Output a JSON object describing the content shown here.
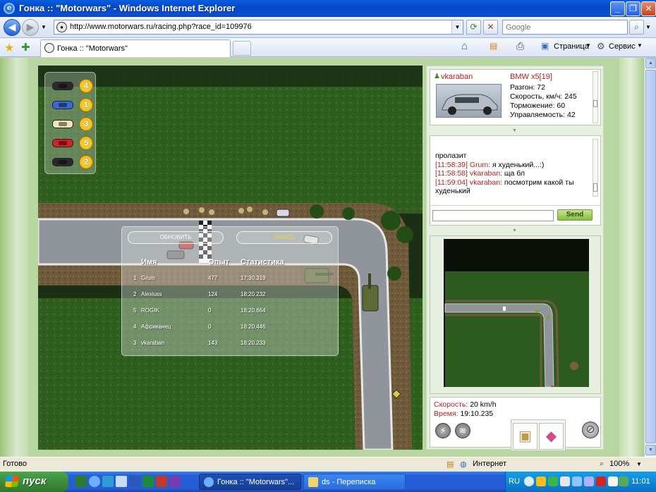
{
  "window": {
    "title": "Гонка :: \"Motorwars\" - Windows Internet Explorer"
  },
  "addressbar": {
    "url": "http://www.motorwars.ru/racing.php?race_id=109976",
    "search_placeholder": "Google"
  },
  "tabs": [
    {
      "label": "Гонка :: \"Motorwars\""
    }
  ],
  "toolbar": {
    "page_label": "Страница",
    "tools_label": "Сервис"
  },
  "leaderboard": [
    {
      "color": "#2a2a2a",
      "position": "4"
    },
    {
      "color": "#3a6ad8",
      "position": "1"
    },
    {
      "color": "#f2e6b8",
      "position": "3"
    },
    {
      "color": "#d42121",
      "position": "5"
    },
    {
      "color": "#2a2a2a",
      "position": "2"
    }
  ],
  "results": {
    "refresh_label": "ОБНОВИТЬ",
    "exit_label": "ВЫХОД",
    "headers": {
      "name": "Имя",
      "exp": "Опыт",
      "stats": "Статистика"
    },
    "rows": [
      {
        "pos": "1",
        "name": "Grum",
        "exp": "477",
        "time": "17:30.319"
      },
      {
        "pos": "2",
        "name": "Alexiuss",
        "exp": "124",
        "time": "18:20.232"
      },
      {
        "pos": "5",
        "name": "ROGIK",
        "exp": "0",
        "time": "18:20.664"
      },
      {
        "pos": "4",
        "name": "Африканец",
        "exp": "0",
        "time": "18:20.446"
      },
      {
        "pos": "3",
        "name": "vkaraban",
        "exp": "143",
        "time": "18:20.233"
      }
    ]
  },
  "player": {
    "name": "vkaraban",
    "car": "BMW x5[19]",
    "stats": [
      {
        "label": "Разгон:",
        "value": "72"
      },
      {
        "label": "Скорость, км/ч:",
        "value": "245"
      },
      {
        "label": "Торможение:",
        "value": "60"
      },
      {
        "label": "Управляемость:",
        "value": "42"
      }
    ]
  },
  "chat": {
    "messages": [
      {
        "time": "",
        "user": "",
        "text": "пролазит"
      },
      {
        "time": "[11:58:39]",
        "user": "Grum:",
        "text": "я худенький...:)"
      },
      {
        "time": "[11:58:58]",
        "user": "vkaraban:",
        "text": "ща бл"
      },
      {
        "time": "[11:59:04]",
        "user": "vkaraban:",
        "text": "посмотрим какой ты худенький"
      }
    ],
    "send_label": "Send",
    "input_value": ""
  },
  "speedometer": {
    "speed_label": "Скорость:",
    "speed_value": "20 km/h",
    "time_label": "Время:",
    "time_value": "19:10.235"
  },
  "statusbar": {
    "status": "Готово",
    "zone": "Интернет",
    "zoom": "100%"
  },
  "taskbar": {
    "start_label": "пуск",
    "buttons": [
      {
        "label": "Гонка :: \"Motorwars\"..."
      },
      {
        "label": "ds - Переписка"
      }
    ],
    "lang": "RU",
    "clock": "11:01"
  }
}
